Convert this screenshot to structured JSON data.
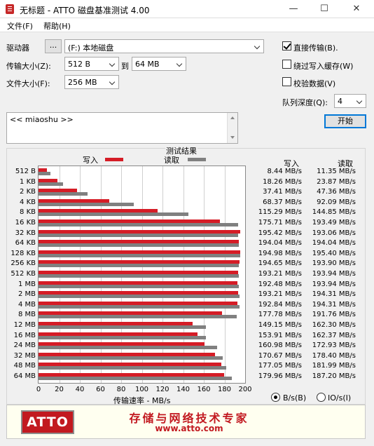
{
  "window": {
    "title": "无标题 - ATTO 磁盘基准测试 4.00",
    "minimize": "—",
    "maximize": "☐",
    "close": "✕"
  },
  "menu": {
    "file": "文件(F)",
    "help": "帮助(H)"
  },
  "drive": {
    "label": "驱动器",
    "browse": "...",
    "value": "(F:) 本地磁盘"
  },
  "transfer": {
    "label": "传输大小(Z):",
    "from": "512 B",
    "to_label": "到",
    "to": "64 MB"
  },
  "filesize": {
    "label": "文件大小(F):",
    "value": "256 MB"
  },
  "options": {
    "direct_io": "直接传输(B).",
    "bypass_cache": "绕过写入缓存(W)",
    "verify": "校验数据(V)",
    "queue_label": "队列深度(Q):",
    "queue_value": "4",
    "start": "开始"
  },
  "notes": {
    "text": "<< miaoshu >>"
  },
  "results": {
    "group_title": "测试结果",
    "legend_write": "写入",
    "legend_read": "读取",
    "col_write": "写入",
    "col_read": "读取",
    "x_axis_title": "传输速率 - MB/s",
    "unit_bytes": "B/s(B)",
    "unit_io": "IO/s(I)"
  },
  "colors": {
    "write": "#d51c26",
    "read": "#808080"
  },
  "chart_data": {
    "type": "bar",
    "orientation": "horizontal",
    "categories": [
      "512 B",
      "1 KB",
      "2 KB",
      "4 KB",
      "8 KB",
      "16 KB",
      "32 KB",
      "64 KB",
      "128 KB",
      "256 KB",
      "512 KB",
      "1 MB",
      "2 MB",
      "4 MB",
      "8 MB",
      "12 MB",
      "16 MB",
      "24 MB",
      "32 MB",
      "48 MB",
      "64 MB"
    ],
    "series": [
      {
        "name": "写入",
        "values": [
          8.44,
          18.26,
          37.41,
          68.37,
          115.29,
          175.71,
          195.42,
          194.04,
          194.98,
          194.65,
          193.21,
          192.48,
          193.21,
          192.84,
          177.78,
          149.15,
          153.91,
          160.98,
          170.67,
          177.05,
          179.96
        ]
      },
      {
        "name": "读取",
        "values": [
          11.35,
          23.87,
          47.36,
          92.09,
          144.85,
          193.49,
          193.06,
          194.04,
          195.4,
          193.9,
          193.94,
          193.94,
          194.31,
          194.31,
          191.76,
          162.3,
          162.37,
          172.93,
          178.4,
          181.99,
          187.2
        ]
      }
    ],
    "write_text": [
      "8.44 MB/s",
      "18.26 MB/s",
      "37.41 MB/s",
      "68.37 MB/s",
      "115.29 MB/s",
      "175.71 MB/s",
      "195.42 MB/s",
      "194.04 MB/s",
      "194.98 MB/s",
      "194.65 MB/s",
      "193.21 MB/s",
      "192.48 MB/s",
      "193.21 MB/s",
      "192.84 MB/s",
      "177.78 MB/s",
      "149.15 MB/s",
      "153.91 MB/s",
      "160.98 MB/s",
      "170.67 MB/s",
      "177.05 MB/s",
      "179.96 MB/s"
    ],
    "read_text": [
      "11.35 MB/s",
      "23.87 MB/s",
      "47.36 MB/s",
      "92.09 MB/s",
      "144.85 MB/s",
      "193.49 MB/s",
      "193.06 MB/s",
      "194.04 MB/s",
      "195.40 MB/s",
      "193.90 MB/s",
      "193.94 MB/s",
      "193.94 MB/s",
      "194.31 MB/s",
      "194.31 MB/s",
      "191.76 MB/s",
      "162.30 MB/s",
      "162.37 MB/s",
      "172.93 MB/s",
      "178.40 MB/s",
      "181.99 MB/s",
      "187.20 MB/s"
    ],
    "xticks": [
      "0",
      "20",
      "40",
      "60",
      "80",
      "100",
      "120",
      "140",
      "160",
      "180",
      "200"
    ],
    "xlim": [
      0,
      200
    ],
    "xlabel": "传输速率 - MB/s",
    "grid": true
  },
  "banner": {
    "logo": "ATTO",
    "slogan": "存储与网络技术专家",
    "website": "www.atto.com"
  }
}
